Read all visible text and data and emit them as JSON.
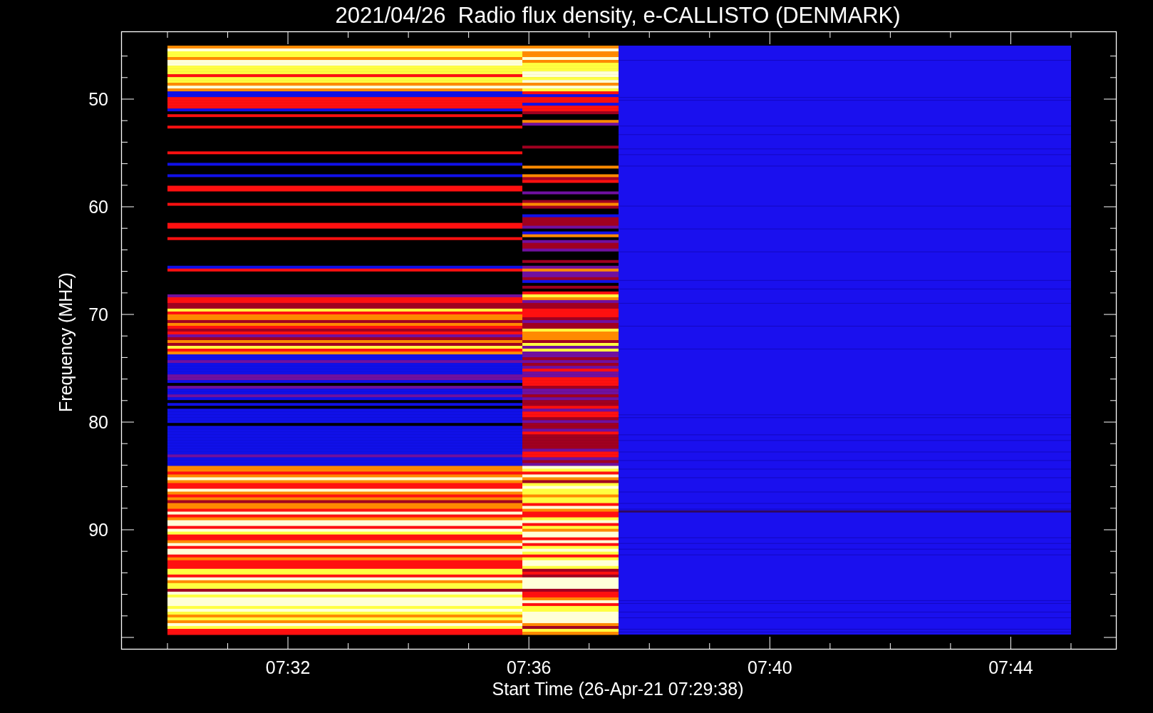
{
  "title": "2021/04/26  Radio flux density, e-CALLISTO (DENMARK)",
  "y_axis": {
    "label": "Frequency (MHZ)",
    "ticks": [
      "50",
      "60",
      "70",
      "80",
      "90"
    ]
  },
  "x_axis": {
    "label": "Start Time (26-Apr-21 07:29:38)",
    "ticks": [
      "07:32",
      "07:36",
      "07:40",
      "07:44"
    ]
  }
}
